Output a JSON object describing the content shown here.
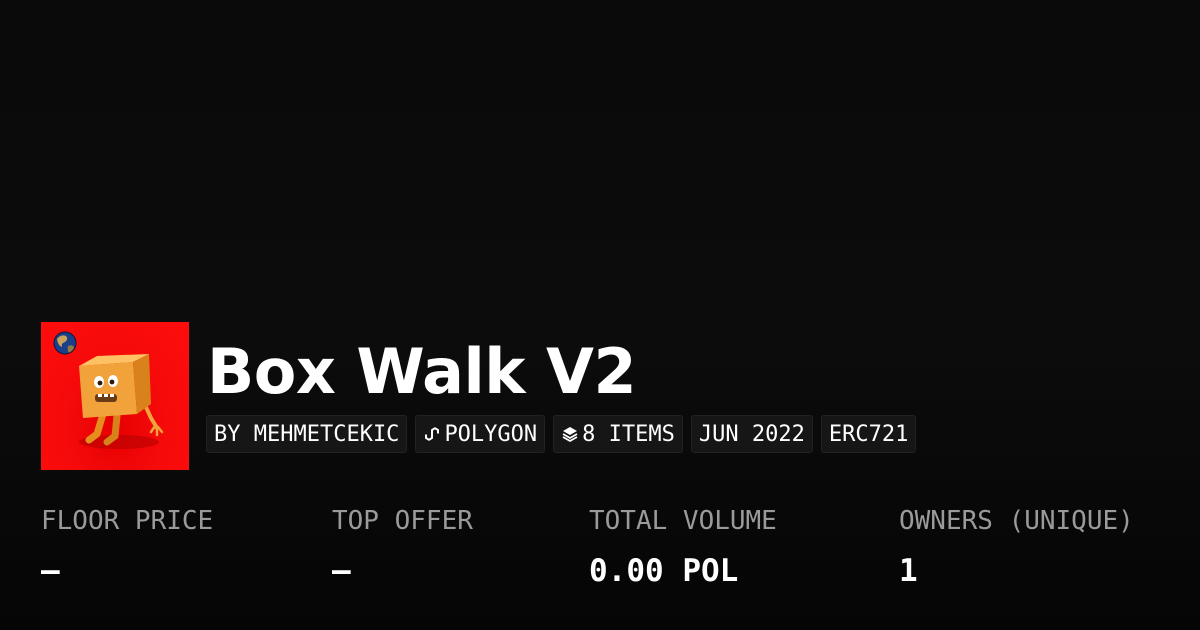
{
  "collection": {
    "name": "Box Walk V2",
    "thumbnail": {
      "background_color": "#ff0000",
      "image": "orange-box-character"
    },
    "badge_icon": "earth-globe-icon"
  },
  "tags": [
    {
      "text": "BY MEHMETCEKIC",
      "icon": null
    },
    {
      "text": "POLYGON",
      "icon": "polygon-chain-icon"
    },
    {
      "text": "8 ITEMS",
      "icon": "layers-icon"
    },
    {
      "text": "JUN 2022",
      "icon": null
    },
    {
      "text": "ERC721",
      "icon": null
    }
  ],
  "stats": [
    {
      "label": "FLOOR PRICE",
      "value": "–"
    },
    {
      "label": "TOP OFFER",
      "value": "–"
    },
    {
      "label": "TOTAL VOLUME",
      "value": "0.00 POL"
    },
    {
      "label": "OWNERS (UNIQUE)",
      "value": "1"
    }
  ],
  "colors": {
    "background": "#0a0a0a",
    "tag_background": "#161616",
    "label_text": "#9a9a9a",
    "value_text": "#ffffff"
  }
}
